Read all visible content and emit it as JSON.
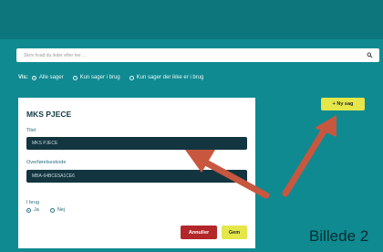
{
  "search": {
    "placeholder": "Skriv hvad du leder efter her ...",
    "icon": "search-icon"
  },
  "filter": {
    "label": "Vis:",
    "options": [
      "Alle sager",
      "Kun sager i brug",
      "Kun sager der ikke er i brug"
    ],
    "selected": "Alle sager"
  },
  "new_case_button": "+ Ny sag",
  "form": {
    "title": "MKS PJECE",
    "title_label": "Titel",
    "title_value": "MKS PJECE",
    "code_label": "Overførelseskode",
    "code_value": "MBA-64BCE5A1CE6",
    "in_use_label": "I brug",
    "in_use_options": [
      "Ja",
      "Nej"
    ],
    "in_use_selected": "Ja",
    "cancel_label": "Annuller",
    "save_label": "Gem"
  },
  "caption": "Billede 2",
  "colors": {
    "background": "#0f8a91",
    "top_bar": "#0d767c",
    "field_bg": "#123540",
    "accent_yellow": "#e4e64a",
    "cancel_red": "#b3262a",
    "arrow": "#c8573f"
  }
}
